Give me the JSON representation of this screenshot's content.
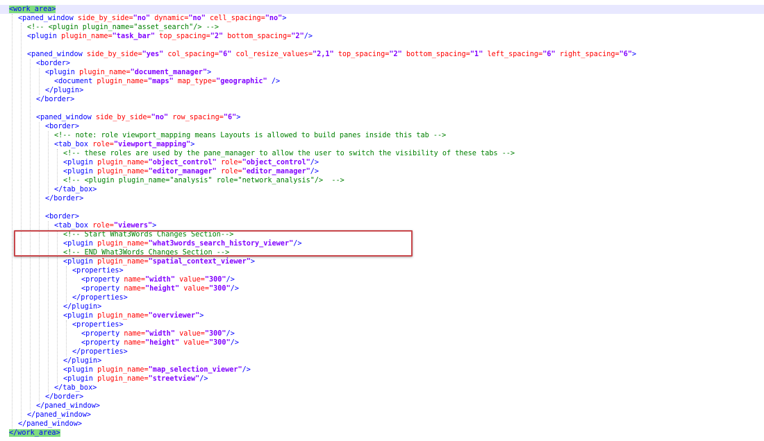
{
  "highlight_color": "#7fdc7f",
  "annotation_color": "#c8464a",
  "lines": [
    {
      "indent": 0,
      "hl": true,
      "tokens": [
        {
          "c": "match",
          "t": "<work_area>"
        }
      ]
    },
    {
      "indent": 1,
      "tokens": [
        {
          "c": "tag",
          "t": "<paned_window"
        },
        {
          "c": "attr",
          "t": " side_by_side="
        },
        {
          "c": "val",
          "t": "\"no\""
        },
        {
          "c": "attr",
          "t": " dynamic="
        },
        {
          "c": "val",
          "t": "\"no\""
        },
        {
          "c": "attr",
          "t": " cell_spacing="
        },
        {
          "c": "val",
          "t": "\"no\""
        },
        {
          "c": "tag",
          "t": ">"
        }
      ]
    },
    {
      "indent": 2,
      "tokens": [
        {
          "c": "cmt",
          "t": "<!-- <plugin plugin_name=\"asset_search\"/> -->"
        }
      ]
    },
    {
      "indent": 2,
      "tokens": [
        {
          "c": "tag",
          "t": "<plugin"
        },
        {
          "c": "attr",
          "t": " plugin_name="
        },
        {
          "c": "val",
          "t": "\"task_bar\""
        },
        {
          "c": "attr",
          "t": " top_spacing="
        },
        {
          "c": "val",
          "t": "\"2\""
        },
        {
          "c": "attr",
          "t": " bottom_spacing="
        },
        {
          "c": "val",
          "t": "\"2\""
        },
        {
          "c": "tag",
          "t": "/>"
        }
      ]
    },
    {
      "indent": 0,
      "tokens": []
    },
    {
      "indent": 2,
      "tokens": [
        {
          "c": "tag",
          "t": "<paned_window"
        },
        {
          "c": "attr",
          "t": " side_by_side="
        },
        {
          "c": "val",
          "t": "\"yes\""
        },
        {
          "c": "attr",
          "t": " col_spacing="
        },
        {
          "c": "val",
          "t": "\"6\""
        },
        {
          "c": "attr",
          "t": " col_resize_values="
        },
        {
          "c": "val",
          "t": "\"2,1\""
        },
        {
          "c": "attr",
          "t": " top_spacing="
        },
        {
          "c": "val",
          "t": "\"2\""
        },
        {
          "c": "attr",
          "t": " bottom_spacing="
        },
        {
          "c": "val",
          "t": "\"1\""
        },
        {
          "c": "attr",
          "t": " left_spacing="
        },
        {
          "c": "val",
          "t": "\"6\""
        },
        {
          "c": "attr",
          "t": " right_spacing="
        },
        {
          "c": "val",
          "t": "\"6\""
        },
        {
          "c": "tag",
          "t": ">"
        }
      ]
    },
    {
      "indent": 3,
      "tokens": [
        {
          "c": "tag",
          "t": "<border>"
        }
      ]
    },
    {
      "indent": 4,
      "tokens": [
        {
          "c": "tag",
          "t": "<plugin"
        },
        {
          "c": "attr",
          "t": " plugin_name="
        },
        {
          "c": "val",
          "t": "\"document_manager\""
        },
        {
          "c": "tag",
          "t": ">"
        }
      ]
    },
    {
      "indent": 5,
      "tokens": [
        {
          "c": "tag",
          "t": "<document"
        },
        {
          "c": "attr",
          "t": " plugin_name="
        },
        {
          "c": "val",
          "t": "\"maps\""
        },
        {
          "c": "attr",
          "t": " map_type="
        },
        {
          "c": "val",
          "t": "\"geographic\""
        },
        {
          "c": "tag",
          "t": " />"
        }
      ]
    },
    {
      "indent": 4,
      "tokens": [
        {
          "c": "tag",
          "t": "</plugin>"
        }
      ]
    },
    {
      "indent": 3,
      "tokens": [
        {
          "c": "tag",
          "t": "</border>"
        }
      ]
    },
    {
      "indent": 0,
      "tokens": []
    },
    {
      "indent": 3,
      "tokens": [
        {
          "c": "tag",
          "t": "<paned_window"
        },
        {
          "c": "attr",
          "t": " side_by_side="
        },
        {
          "c": "val",
          "t": "\"no\""
        },
        {
          "c": "attr",
          "t": " row_spacing="
        },
        {
          "c": "val",
          "t": "\"6\""
        },
        {
          "c": "tag",
          "t": ">"
        }
      ]
    },
    {
      "indent": 4,
      "tokens": [
        {
          "c": "tag",
          "t": "<border>"
        }
      ]
    },
    {
      "indent": 5,
      "tokens": [
        {
          "c": "cmt",
          "t": "<!-- note: role viewport_mapping means Layouts is allowed to build panes inside this tab -->"
        }
      ]
    },
    {
      "indent": 5,
      "tokens": [
        {
          "c": "tag",
          "t": "<tab_box"
        },
        {
          "c": "attr",
          "t": " role="
        },
        {
          "c": "val",
          "t": "\"viewport_mapping\""
        },
        {
          "c": "tag",
          "t": ">"
        }
      ]
    },
    {
      "indent": 6,
      "tokens": [
        {
          "c": "cmt",
          "t": "<!-- these roles are used by the pane_manager to allow the user to switch the visibility of these tabs -->"
        }
      ]
    },
    {
      "indent": 6,
      "tokens": [
        {
          "c": "tag",
          "t": "<plugin"
        },
        {
          "c": "attr",
          "t": " plugin_name="
        },
        {
          "c": "val",
          "t": "\"object_control\""
        },
        {
          "c": "attr",
          "t": " role="
        },
        {
          "c": "val",
          "t": "\"object_control\""
        },
        {
          "c": "tag",
          "t": "/>"
        }
      ]
    },
    {
      "indent": 6,
      "tokens": [
        {
          "c": "tag",
          "t": "<plugin"
        },
        {
          "c": "attr",
          "t": " plugin_name="
        },
        {
          "c": "val",
          "t": "\"editor_manager\""
        },
        {
          "c": "attr",
          "t": " role="
        },
        {
          "c": "val",
          "t": "\"editor_manager\""
        },
        {
          "c": "tag",
          "t": "/>"
        }
      ]
    },
    {
      "indent": 6,
      "tokens": [
        {
          "c": "cmt",
          "t": "<!-- <plugin plugin_name=\"analysis\" role=\"network_analysis\"/>  -->"
        }
      ]
    },
    {
      "indent": 5,
      "tokens": [
        {
          "c": "tag",
          "t": "</tab_box>"
        }
      ]
    },
    {
      "indent": 4,
      "tokens": [
        {
          "c": "tag",
          "t": "</border>"
        }
      ]
    },
    {
      "indent": 0,
      "tokens": []
    },
    {
      "indent": 4,
      "tokens": [
        {
          "c": "tag",
          "t": "<border>"
        }
      ]
    },
    {
      "indent": 5,
      "tokens": [
        {
          "c": "tag",
          "t": "<tab_box"
        },
        {
          "c": "attr",
          "t": " role="
        },
        {
          "c": "val",
          "t": "\"viewers\""
        },
        {
          "c": "tag",
          "t": ">"
        }
      ]
    },
    {
      "indent": 6,
      "tokens": [
        {
          "c": "cmt",
          "t": "<!-- Start What3Words Changes Section-->"
        }
      ]
    },
    {
      "indent": 6,
      "tokens": [
        {
          "c": "tag",
          "t": "<plugin"
        },
        {
          "c": "attr",
          "t": " plugin_name="
        },
        {
          "c": "val",
          "t": "\"what3words_search_history_viewer\""
        },
        {
          "c": "tag",
          "t": "/>"
        }
      ]
    },
    {
      "indent": 6,
      "tokens": [
        {
          "c": "cmt",
          "t": "<!-- END What3Words Changes Section -->"
        }
      ]
    },
    {
      "indent": 6,
      "tokens": [
        {
          "c": "tag",
          "t": "<plugin"
        },
        {
          "c": "attr",
          "t": " plugin_name="
        },
        {
          "c": "val",
          "t": "\"spatial_context_viewer\""
        },
        {
          "c": "tag",
          "t": ">"
        }
      ]
    },
    {
      "indent": 7,
      "tokens": [
        {
          "c": "tag",
          "t": "<properties>"
        }
      ]
    },
    {
      "indent": 8,
      "tokens": [
        {
          "c": "tag",
          "t": "<property"
        },
        {
          "c": "attr",
          "t": " name="
        },
        {
          "c": "val",
          "t": "\"width\""
        },
        {
          "c": "attr",
          "t": " value="
        },
        {
          "c": "val",
          "t": "\"300\""
        },
        {
          "c": "tag",
          "t": "/>"
        }
      ]
    },
    {
      "indent": 8,
      "tokens": [
        {
          "c": "tag",
          "t": "<property"
        },
        {
          "c": "attr",
          "t": " name="
        },
        {
          "c": "val",
          "t": "\"height\""
        },
        {
          "c": "attr",
          "t": " value="
        },
        {
          "c": "val",
          "t": "\"300\""
        },
        {
          "c": "tag",
          "t": "/>"
        }
      ]
    },
    {
      "indent": 7,
      "tokens": [
        {
          "c": "tag",
          "t": "</properties>"
        }
      ]
    },
    {
      "indent": 6,
      "tokens": [
        {
          "c": "tag",
          "t": "</plugin>"
        }
      ]
    },
    {
      "indent": 6,
      "tokens": [
        {
          "c": "tag",
          "t": "<plugin"
        },
        {
          "c": "attr",
          "t": " plugin_name="
        },
        {
          "c": "val",
          "t": "\"overviewer\""
        },
        {
          "c": "tag",
          "t": ">"
        }
      ]
    },
    {
      "indent": 7,
      "tokens": [
        {
          "c": "tag",
          "t": "<properties>"
        }
      ]
    },
    {
      "indent": 8,
      "tokens": [
        {
          "c": "tag",
          "t": "<property"
        },
        {
          "c": "attr",
          "t": " name="
        },
        {
          "c": "val",
          "t": "\"width\""
        },
        {
          "c": "attr",
          "t": " value="
        },
        {
          "c": "val",
          "t": "\"300\""
        },
        {
          "c": "tag",
          "t": "/>"
        }
      ]
    },
    {
      "indent": 8,
      "tokens": [
        {
          "c": "tag",
          "t": "<property"
        },
        {
          "c": "attr",
          "t": " name="
        },
        {
          "c": "val",
          "t": "\"height\""
        },
        {
          "c": "attr",
          "t": " value="
        },
        {
          "c": "val",
          "t": "\"300\""
        },
        {
          "c": "tag",
          "t": "/>"
        }
      ]
    },
    {
      "indent": 7,
      "tokens": [
        {
          "c": "tag",
          "t": "</properties>"
        }
      ]
    },
    {
      "indent": 6,
      "tokens": [
        {
          "c": "tag",
          "t": "</plugin>"
        }
      ]
    },
    {
      "indent": 6,
      "tokens": [
        {
          "c": "tag",
          "t": "<plugin"
        },
        {
          "c": "attr",
          "t": " plugin_name="
        },
        {
          "c": "val",
          "t": "\"map_selection_viewer\""
        },
        {
          "c": "tag",
          "t": "/>"
        }
      ]
    },
    {
      "indent": 6,
      "tokens": [
        {
          "c": "tag",
          "t": "<plugin"
        },
        {
          "c": "attr",
          "t": " plugin_name="
        },
        {
          "c": "val",
          "t": "\"streetview\""
        },
        {
          "c": "tag",
          "t": "/>"
        }
      ]
    },
    {
      "indent": 5,
      "tokens": [
        {
          "c": "tag",
          "t": "</tab_box>"
        }
      ]
    },
    {
      "indent": 4,
      "tokens": [
        {
          "c": "tag",
          "t": "</border>"
        }
      ]
    },
    {
      "indent": 3,
      "tokens": [
        {
          "c": "tag",
          "t": "</paned_window>"
        }
      ]
    },
    {
      "indent": 2,
      "tokens": [
        {
          "c": "tag",
          "t": "</paned_window>"
        }
      ]
    },
    {
      "indent": 1,
      "tokens": [
        {
          "c": "tag",
          "t": "</paned_window>"
        }
      ]
    },
    {
      "indent": 0,
      "tokens": [
        {
          "c": "match",
          "t": "</work_area>"
        }
      ]
    }
  ]
}
